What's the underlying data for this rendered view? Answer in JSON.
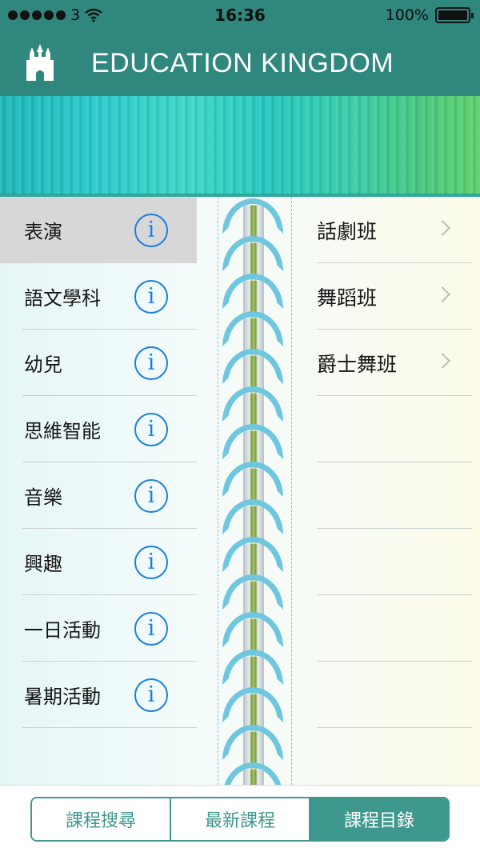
{
  "status_bar": {
    "carrier": "3",
    "time": "16:36",
    "battery": "100%"
  },
  "nav": {
    "title": "EDUCATION KINGDOM",
    "icon": "castle-icon"
  },
  "categories": [
    {
      "label": "表演",
      "selected": true
    },
    {
      "label": "語文學科"
    },
    {
      "label": "幼兒"
    },
    {
      "label": "思維智能"
    },
    {
      "label": "音樂"
    },
    {
      "label": "興趣"
    },
    {
      "label": "一日活動"
    },
    {
      "label": "暑期活動"
    }
  ],
  "info_icon_glyph": "i",
  "subcategories": [
    {
      "label": "話劇班"
    },
    {
      "label": "舞蹈班"
    },
    {
      "label": "爵士舞班"
    }
  ],
  "tabs": [
    {
      "label": "課程搜尋"
    },
    {
      "label": "最新課程"
    },
    {
      "label": "課程目錄",
      "active": true
    }
  ],
  "colors": {
    "accent": "#3f988d",
    "nav_bg": "#2f877d",
    "info_blue": "#1b7fe0",
    "selected_row": "#d7d7d7"
  }
}
